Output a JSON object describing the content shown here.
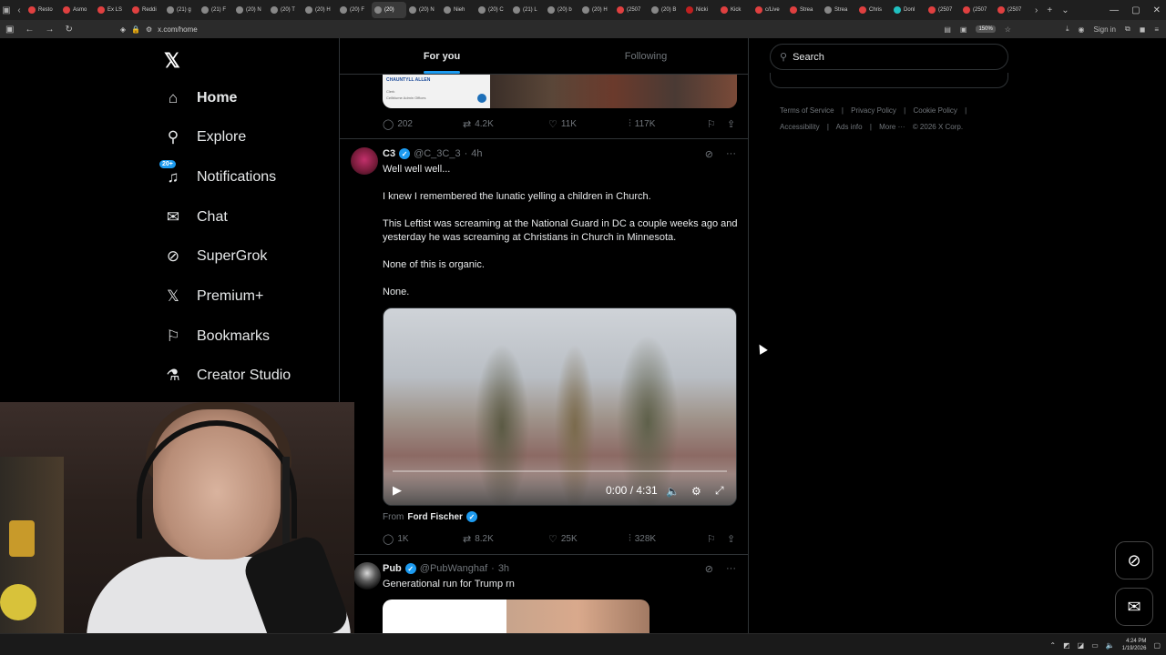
{
  "browser": {
    "tabs": [
      {
        "label": "Resto",
        "color": "#e04040"
      },
      {
        "label": "Asmo",
        "color": "#e04040"
      },
      {
        "label": "Ex LS",
        "color": "#e04040"
      },
      {
        "label": "Reddi",
        "color": "#e04040"
      },
      {
        "label": "(21) g",
        "color": "#888888"
      },
      {
        "label": "(21) F",
        "color": "#888888"
      },
      {
        "label": "(20) N",
        "color": "#888888"
      },
      {
        "label": "(20) T",
        "color": "#888888"
      },
      {
        "label": "(20) H",
        "color": "#888888"
      },
      {
        "label": "(20) F",
        "color": "#888888"
      },
      {
        "label": "(20)",
        "color": "#888888"
      },
      {
        "label": "(20) N",
        "color": "#888888"
      },
      {
        "label": "Nieh",
        "color": "#888888"
      },
      {
        "label": "(20) C",
        "color": "#888888"
      },
      {
        "label": "(21) L",
        "color": "#888888"
      },
      {
        "label": "(20) b",
        "color": "#888888"
      },
      {
        "label": "(20) H",
        "color": "#888888"
      },
      {
        "label": "(2507",
        "color": "#e04040"
      },
      {
        "label": "(20) B",
        "color": "#888888"
      },
      {
        "label": "Nicki",
        "color": "#c02020"
      },
      {
        "label": "Kick",
        "color": "#e04040"
      },
      {
        "label": "c/Live",
        "color": "#e04040"
      },
      {
        "label": "Strea",
        "color": "#e04040"
      },
      {
        "label": "Strea",
        "color": "#888888"
      },
      {
        "label": "Chris",
        "color": "#e04040"
      },
      {
        "label": "Donl",
        "color": "#20c0c0"
      },
      {
        "label": "(2507",
        "color": "#e04040"
      },
      {
        "label": "(2507",
        "color": "#e04040"
      },
      {
        "label": "(2507",
        "color": "#e04040"
      }
    ],
    "active_tab_index": 10,
    "url": "x.com/home",
    "zoom": "150%",
    "sign_in": "Sign in"
  },
  "nav": {
    "home": "Home",
    "explore": "Explore",
    "notifications": "Notifications",
    "notifications_badge": "20+",
    "chat": "Chat",
    "supergrok": "SuperGrok",
    "premium": "Premium+",
    "bookmarks": "Bookmarks",
    "creator_studio": "Creator Studio"
  },
  "feed": {
    "tab_for_you": "For you",
    "tab_following": "Following"
  },
  "prev_tweet": {
    "card_name": "CHAUNTYLL ALLEN",
    "card_line1": "Clerk",
    "card_line2": "Cellblume Admin Offices",
    "replies": "202",
    "reposts": "4.2K",
    "likes": "11K",
    "views": "117K"
  },
  "tweet_c3": {
    "name": "C3",
    "handle": "@C_3C_3",
    "time": "4h",
    "lines": [
      "Well well well...",
      "I knew I remembered the lunatic yelling a children in Church.",
      "This Leftist was screaming at the National Guard in DC a couple weeks ago and yesterday he was screaming at Christians in Church in Minnesota.",
      "None of this is organic.",
      "None."
    ],
    "video_time": "0:00 / 4:31",
    "from_label": "From",
    "from_name": "Ford Fischer",
    "replies": "1K",
    "reposts": "8.2K",
    "likes": "25K",
    "views": "328K"
  },
  "tweet_pub": {
    "name": "Pub",
    "handle": "@PubWanghaf",
    "time": "3h",
    "text": "Generational run for Trump rn"
  },
  "right": {
    "search_placeholder": "Search",
    "footer": [
      "Terms of Service",
      "|",
      "Privacy Policy",
      "|",
      "Cookie Policy",
      "|",
      "Accessibility",
      "|",
      "Ads info",
      "|",
      "More ···",
      "© 2026 X Corp."
    ]
  },
  "taskbar": {
    "time": "4:24 PM",
    "date": "1/19/2026"
  },
  "colors": {
    "accent": "#1d9bf0",
    "background": "#000000",
    "border": "#2f3336",
    "muted": "#71767b"
  }
}
